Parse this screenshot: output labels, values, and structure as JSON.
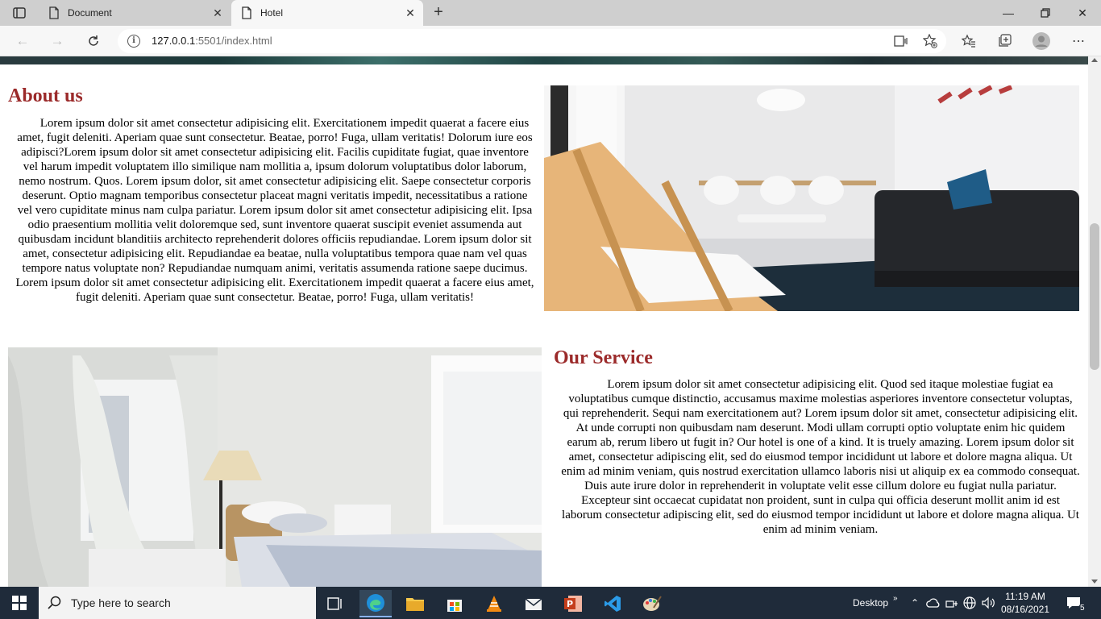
{
  "browser": {
    "tabs": [
      {
        "title": "Document"
      },
      {
        "title": "Hotel"
      }
    ],
    "url": {
      "host": "127.0.0.1",
      "path": ":5501/index.html"
    }
  },
  "page": {
    "about": {
      "title": "About us",
      "text": "Lorem ipsum dolor sit amet consectetur adipisicing elit. Exercitationem impedit quaerat a facere eius amet, fugit deleniti. Aperiam quae sunt consectetur. Beatae, porro! Fuga, ullam veritatis! Dolorum iure eos adipisci?Lorem ipsum dolor sit amet consectetur adipisicing elit. Facilis cupiditate fugiat, quae inventore vel harum impedit voluptatem illo similique nam mollitia a, ipsum dolorum voluptatibus dolor laborum, nemo nostrum. Quos. Lorem ipsum dolor, sit amet consectetur adipisicing elit. Saepe consectetur corporis deserunt. Optio magnam temporibus consectetur placeat magni veritatis impedit, necessitatibus a ratione vel vero cupiditate minus nam culpa pariatur. Lorem ipsum dolor sit amet consectetur adipisicing elit. Ipsa odio praesentium mollitia velit doloremque sed, sunt inventore quaerat suscipit eveniet assumenda aut quibusdam incidunt blanditiis architecto reprehenderit dolores officiis repudiandae. Lorem ipsum dolor sit amet, consectetur adipisicing elit. Repudiandae ea beatae, nulla voluptatibus tempora quae nam vel quas tempore natus voluptate non? Repudiandae numquam animi, veritatis assumenda ratione saepe ducimus. Lorem ipsum dolor sit amet consectetur adipisicing elit. Exercitationem impedit quaerat a facere eius amet, fugit deleniti. Aperiam quae sunt consectetur. Beatae, porro! Fuga, ullam veritatis!"
    },
    "service": {
      "title": "Our Service",
      "text": "Lorem ipsum dolor sit amet consectetur adipisicing elit. Quod sed itaque molestiae fugiat ea voluptatibus cumque distinctio, accusamus maxime molestias asperiores inventore consectetur voluptas, qui reprehenderit. Sequi nam exercitationem aut? Lorem ipsum dolor sit amet, consectetur adipisicing elit. At unde corrupti non quibusdam nam deserunt. Modi ullam corrupti optio voluptate enim hic quidem earum ab, rerum libero ut fugit in? Our hotel is one of a kind. It is truely amazing. Lorem ipsum dolor sit amet, consectetur adipiscing elit, sed do eiusmod tempor incididunt ut labore et dolore magna aliqua. Ut enim ad minim veniam, quis nostrud exercitation ullamco laboris nisi ut aliquip ex ea commodo consequat. Duis aute irure dolor in reprehenderit in voluptate velit esse cillum dolore eu fugiat nulla pariatur. Excepteur sint occaecat cupidatat non proident, sunt in culpa qui officia deserunt mollit anim id est laborum consectetur adipiscing elit, sed do eiusmod tempor incididunt ut labore et dolore magna aliqua. Ut enim ad minim veniam."
    }
  },
  "taskbar": {
    "search_placeholder": "Type here to search",
    "desktop_label": "Desktop",
    "time": "11:19 AM",
    "date": "08/16/2021",
    "notification_count": "5"
  },
  "colors": {
    "heading": "#9b2a2a",
    "taskbar": "#1f2b3a"
  }
}
